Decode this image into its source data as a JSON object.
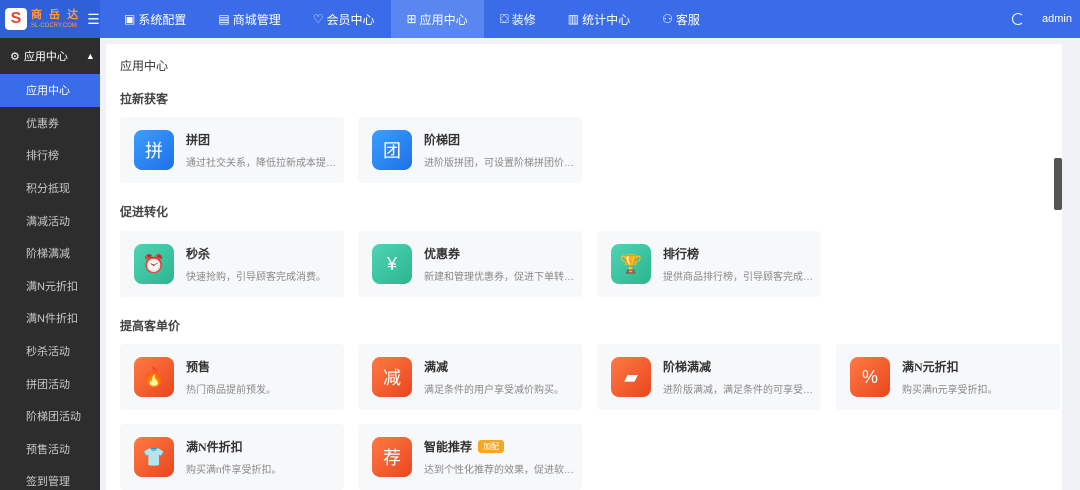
{
  "brand": {
    "logo_char": "S",
    "name_cn": "商 岳 达",
    "name_en": "SL-COCRY.COM",
    "toggle_icon": "menu-icon"
  },
  "nav": [
    {
      "label": "系统配置",
      "icon": "monitor-icon",
      "glyph": "▣",
      "active": false
    },
    {
      "label": "商城管理",
      "icon": "store-icon",
      "glyph": "▤",
      "active": false
    },
    {
      "label": "会员中心",
      "icon": "heart-icon",
      "glyph": "♡",
      "active": false
    },
    {
      "label": "应用中心",
      "icon": "apps-icon",
      "glyph": "⊞",
      "active": true
    },
    {
      "label": "装修",
      "icon": "brush-icon",
      "glyph": "⛋",
      "active": false
    },
    {
      "label": "统计中心",
      "icon": "chart-icon",
      "glyph": "▥",
      "active": false
    },
    {
      "label": "客服",
      "icon": "user-icon",
      "glyph": "⚇",
      "active": false
    }
  ],
  "user": {
    "name": "admin"
  },
  "sidebar": {
    "group": "应用中心",
    "items": [
      "应用中心",
      "优惠券",
      "排行榜",
      "积分抵现",
      "满减活动",
      "阶梯满减",
      "满N元折扣",
      "满N件折扣",
      "秒杀活动",
      "拼团活动",
      "阶梯团活动",
      "预售活动",
      "签到管理"
    ],
    "active_index": 0
  },
  "main": {
    "title": "应用中心",
    "sections": [
      {
        "title": "拉新获客",
        "cards": [
          {
            "title": "拼团",
            "desc": "通过社交关系，降低拉新成本提…",
            "color": "blue",
            "icon": "group-buy-icon",
            "glyph": "拼"
          },
          {
            "title": "阶梯团",
            "desc": "进阶版拼团，可设置阶梯拼团价…",
            "color": "blue",
            "icon": "tier-group-icon",
            "glyph": "团"
          }
        ]
      },
      {
        "title": "促进转化",
        "cards": [
          {
            "title": "秒杀",
            "desc": "快速抢购，引导顾客完成消费。",
            "color": "green",
            "icon": "alarm-clock-icon",
            "glyph": "⏰"
          },
          {
            "title": "优惠券",
            "desc": "新建和管理优惠券，促进下单转…",
            "color": "green",
            "icon": "coupon-icon",
            "glyph": "¥"
          },
          {
            "title": "排行榜",
            "desc": "提供商品排行榜，引导顾客完成…",
            "color": "green",
            "icon": "trophy-icon",
            "glyph": "🏆"
          }
        ]
      },
      {
        "title": "提高客单价",
        "cards": [
          {
            "title": "预售",
            "desc": "热门商品提前预发。",
            "color": "red",
            "icon": "flame-icon",
            "glyph": "🔥"
          },
          {
            "title": "满减",
            "desc": "满足条件的用户享受减价购买。",
            "color": "red",
            "icon": "discount-tag-icon",
            "glyph": "减"
          },
          {
            "title": "阶梯满减",
            "desc": "进阶版满减，满足条件的可享受…",
            "color": "red",
            "icon": "ticket-icon",
            "glyph": "▰"
          },
          {
            "title": "满N元折扣",
            "desc": "购买满n元享受折扣。",
            "color": "red",
            "icon": "price-tag-icon",
            "glyph": "%"
          },
          {
            "title": "满N件折扣",
            "desc": "购买满n件享受折扣。",
            "color": "red",
            "icon": "shirt-icon",
            "glyph": "👕"
          },
          {
            "title": "智能推荐",
            "desc": "达到个性化推荐的效果，促进软…",
            "color": "red",
            "icon": "recommend-icon",
            "glyph": "荐",
            "badge": "加配"
          }
        ]
      }
    ]
  }
}
